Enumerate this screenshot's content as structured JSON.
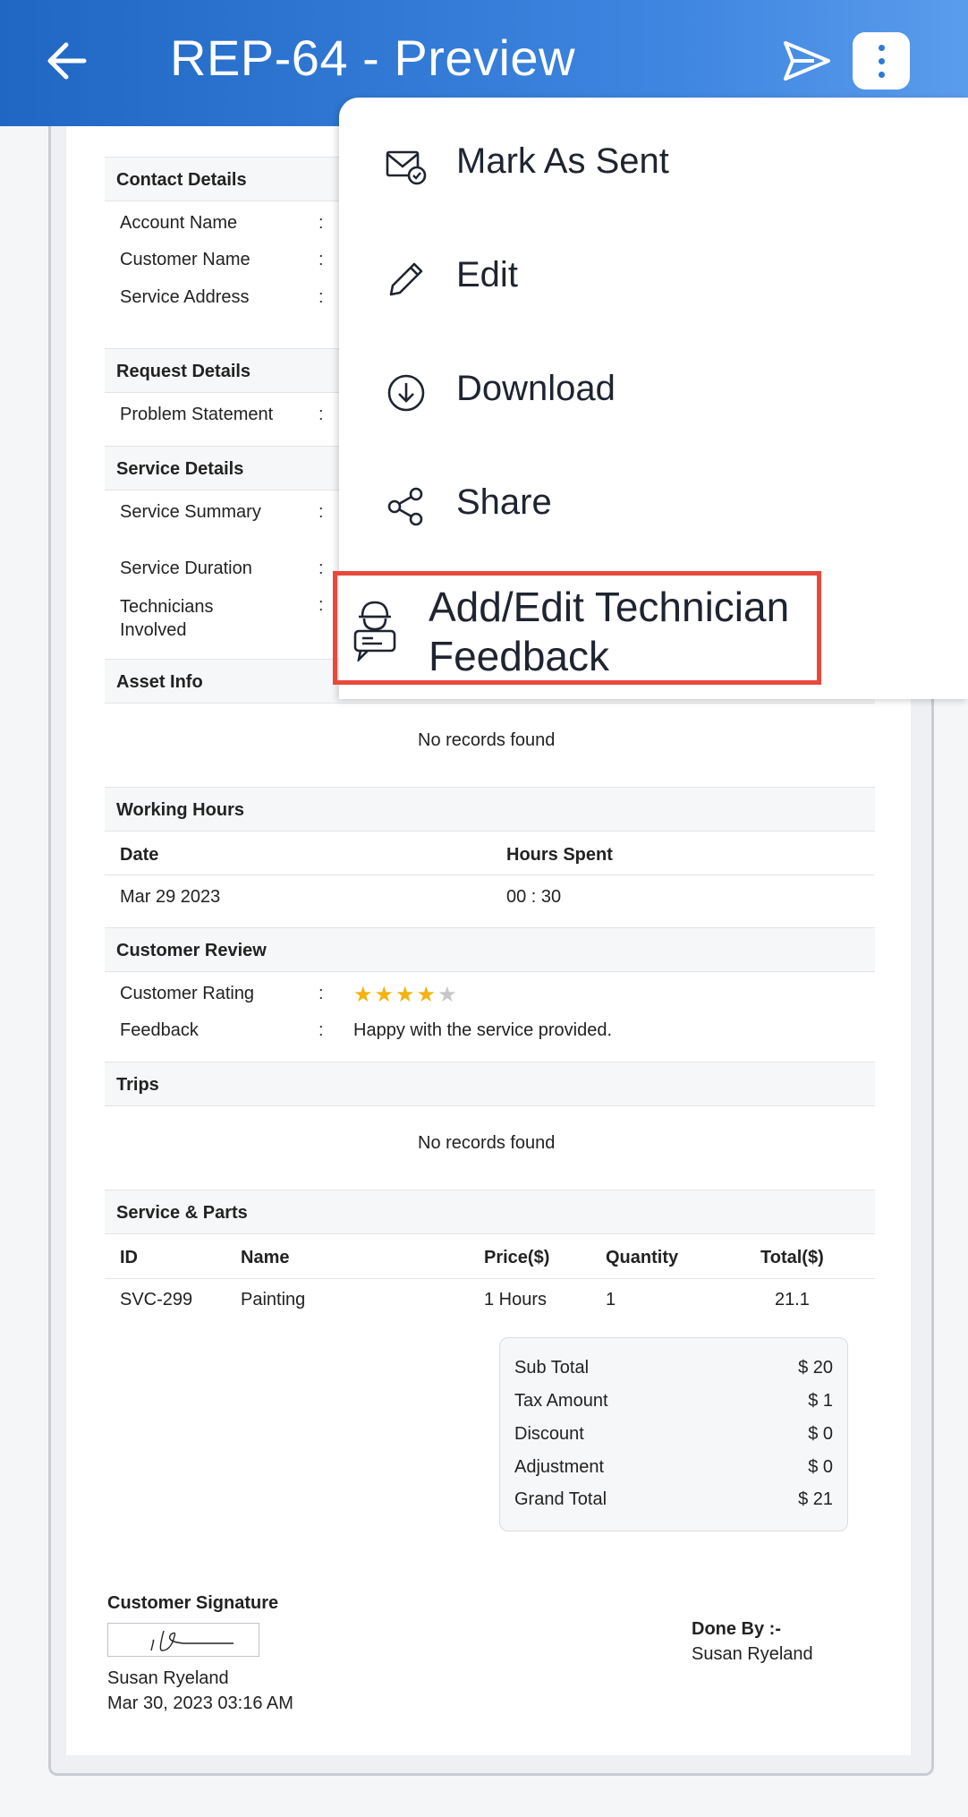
{
  "header": {
    "title": "REP-64 - Preview",
    "back_icon": "arrow-left-icon",
    "send_icon": "send-icon",
    "more_icon": "more-vertical-icon"
  },
  "contact_details": {
    "heading": "Contact Details",
    "fields": [
      {
        "label": "Account Name"
      },
      {
        "label": "Customer Name"
      },
      {
        "label": "Service Address"
      }
    ]
  },
  "request_details": {
    "heading": "Request Details",
    "fields": [
      {
        "label": "Problem Statement"
      }
    ]
  },
  "service_details": {
    "heading": "Service Details",
    "fields": [
      {
        "label": "Service Summary"
      },
      {
        "label": "Service Duration"
      },
      {
        "label": "Technicians Involved"
      }
    ]
  },
  "asset_info": {
    "heading": "Asset Info",
    "empty_text": "No records found"
  },
  "working_hours": {
    "heading": "Working Hours",
    "columns": [
      "Date",
      "Hours Spent"
    ],
    "rows": [
      [
        "Mar 29 2023",
        "00 : 30"
      ]
    ]
  },
  "customer_review": {
    "heading": "Customer Review",
    "rating_label": "Customer Rating",
    "rating": 4,
    "rating_max": 5,
    "feedback_label": "Feedback",
    "feedback": "Happy with the service provided."
  },
  "trips": {
    "heading": "Trips",
    "empty_text": "No records found"
  },
  "service_parts": {
    "heading": "Service & Parts",
    "columns": [
      "ID",
      "Name",
      "Price($)",
      "Quantity",
      "Total($)"
    ],
    "rows": [
      [
        "SVC-299",
        "Painting",
        "1 Hours",
        "1",
        "21.1"
      ]
    ]
  },
  "totals": [
    {
      "label": "Sub Total",
      "value": "$ 20"
    },
    {
      "label": "Tax Amount",
      "value": "$ 1"
    },
    {
      "label": "Discount",
      "value": "$ 0"
    },
    {
      "label": "Adjustment",
      "value": "$ 0"
    },
    {
      "label": "Grand Total",
      "value": "$ 21"
    }
  ],
  "signature": {
    "heading": "Customer Signature",
    "name": "Susan Ryeland",
    "date": "Mar 30, 2023 03:16 AM"
  },
  "done_by": {
    "label": "Done By :-",
    "name": "Susan Ryeland"
  },
  "menu": {
    "items": [
      {
        "label": "Mark As Sent",
        "icon": "mail-check-icon"
      },
      {
        "label": "Edit",
        "icon": "pencil-icon"
      },
      {
        "label": "Download",
        "icon": "download-circle-icon"
      },
      {
        "label": "Share",
        "icon": "share-icon"
      },
      {
        "label": "Add/Edit Technician Feedback",
        "icon": "technician-feedback-icon"
      }
    ],
    "highlight_color": "#e8493d"
  },
  "colors": {
    "header_start": "#1f67c3",
    "header_end": "#5a9cec",
    "star": "#f3b20f"
  }
}
